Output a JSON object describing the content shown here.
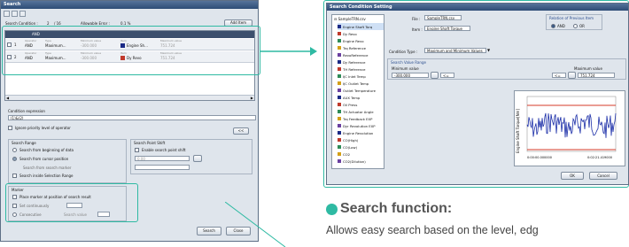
{
  "left_dialog": {
    "title": "Search",
    "search_condition_label": "Search Condition :",
    "search_condition_count": "2",
    "search_condition_sep": "/ 16",
    "allowable_error_label": "Allowable Error :",
    "allowable_error_value": "0.1 %",
    "add_item_label": "Add Item",
    "table": {
      "header": "AND",
      "rows": [
        {
          "index": "1",
          "operator_head": "Operator",
          "operator": "AND",
          "type_head": "Type",
          "type": "Maximum...",
          "min_head": "Minimum value",
          "min": "-300.000",
          "item_head": "Item",
          "item": "Engine Sh...",
          "max_head": "Maximum value",
          "max": "751.724"
        },
        {
          "index": "2",
          "operator_head": "Operator",
          "operator": "AND",
          "type_head": "Type",
          "type": "Maximum...",
          "min_head": "Minimum value",
          "min": "-300.000",
          "item_head": "Item",
          "item": "Dy Revo",
          "max_head": "Maximum value",
          "max": "751.724"
        }
      ]
    },
    "condition_expression_label": "Condition expression",
    "condition_expression_value": "(1)&(2)",
    "ignore_priority_label": "Ignore priority level of operator",
    "ellipsis_btn": "<<",
    "search_range": {
      "title": "Search Range",
      "opt1": "Search from beginning of data",
      "opt2": "Search from cursor position",
      "opt3": "Search from search marker",
      "opt4": "Search inside Selection Range"
    },
    "search_point_shift": {
      "title": "Search Point Shift",
      "checkbox": "Enable search point shift",
      "value": "0.00"
    },
    "marker": {
      "title": "Marker",
      "place": "Place marker at position of search result",
      "set_cont": "Set continuously",
      "consec": "Consecutive",
      "search_value": "Search value"
    },
    "search_btn": "Search",
    "close_btn": "Close"
  },
  "right_dialog": {
    "title": "Search Condition Setting",
    "tree": {
      "root": "SampleTRN.csv",
      "items": [
        "Engine Shaft Torq",
        "Dy Revo",
        "Engine Revo",
        "Trq Reference",
        "RevoReference",
        "Dy Reference",
        "TH Reference",
        "IJC Inlet Temp",
        "IJC Outlet Temp",
        "Outlet Temperature",
        "AUX Temp",
        "Oil Press",
        "TH Actuator Angle",
        "Trq Feedback EXP",
        "Dyr Revolution EXP",
        "Engine Revolution",
        "CO(High)",
        "CO(Low)",
        "CO2",
        "CO2(Dilution)"
      ]
    },
    "file_label": "File :",
    "file_value": "SampleTRN.csv",
    "item_label": "Item :",
    "item_value": "Engine Shaft Torque",
    "relation_title": "Relation of Previous Item",
    "and_label": "AND",
    "or_label": "OR",
    "condition_type_label": "Condition Type :",
    "condition_type_value": "Maximum and Minimum Values",
    "range_title": "Search Value Range",
    "min_label": "Minimum value",
    "min_value": "-300.000",
    "min_op": "<=",
    "max_label": "Maximum value",
    "max_value": "751.724",
    "max_op": "<=",
    "graph": {
      "ylabel": "Engine Shaft Torque[Nm]",
      "x_start": "0:00:00.000000",
      "x_end": "0:02:21.419000"
    },
    "ok_btn": "OK",
    "cancel_btn": "Cancel"
  },
  "caption": {
    "heading": "Search function:",
    "description": "Allows easy search based on the level, edg"
  },
  "colors": {
    "highlight": "#2fbaa3",
    "title_bar": "#3a5a85",
    "accent_red": "#d43b2a",
    "graph_line": "#1b2ea8"
  }
}
